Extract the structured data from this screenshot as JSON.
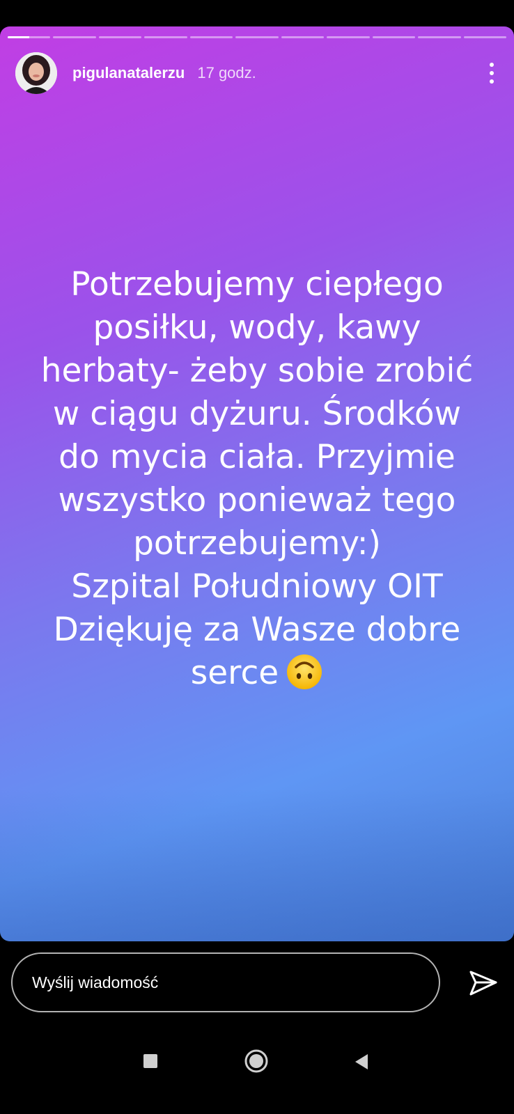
{
  "story": {
    "progress": {
      "segments": 11,
      "current_index": 0,
      "current_fill": 0.5
    },
    "author": {
      "username": "pigulanatalerzu",
      "time_ago": "17 godz."
    },
    "text": "Potrzebujemy ciepłego\nposiłku, wody, kawy\nherbaty- żeby sobie zrobić\nw ciągu dyżuru. Środków\ndo mycia ciała. Przyjmie\nwszystko ponieważ tego\npotrzebujemy:)\nSzpital Południowy OIT\nDziękuję za Wasze dobre\nserce",
    "emoji": "upside-down-face-emoji",
    "gradient_colors": [
      "#c13ee4",
      "#9b52ea",
      "#7b78ee",
      "#5f96f4",
      "#4a7fd8"
    ]
  },
  "reply_bar": {
    "placeholder": "Wyślij wiadomość",
    "send_icon": "send-icon"
  },
  "navigation": {
    "buttons": [
      "recent-apps-icon",
      "home-icon",
      "back-icon"
    ]
  }
}
